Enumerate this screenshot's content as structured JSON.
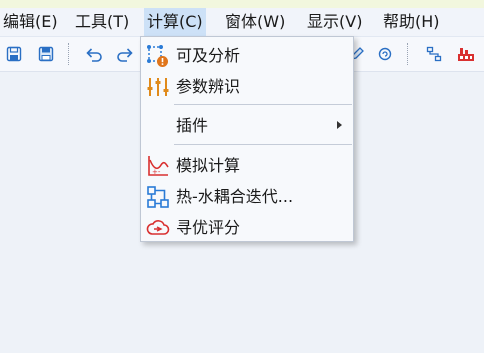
{
  "menubar": {
    "items": [
      {
        "label": "编辑(E)"
      },
      {
        "label": "工具(T)"
      },
      {
        "label": "计算(C)"
      },
      {
        "label": "窗体(W)"
      },
      {
        "label": "显示(V)"
      },
      {
        "label": "帮助(H)"
      }
    ],
    "active_index": 2
  },
  "toolbar": {
    "icons": [
      "save-icon",
      "save-as-icon",
      "undo-icon",
      "redo-icon",
      "edit-icon",
      "refresh-icon",
      "network-icon",
      "factory-icon"
    ]
  },
  "calc_menu": {
    "items": [
      {
        "label": "可及分析",
        "icon": "reachability-analysis-icon"
      },
      {
        "label": "参数辨识",
        "icon": "parameter-identification-icon"
      },
      {
        "label": "插件",
        "icon": "",
        "has_submenu": true
      },
      {
        "label": "模拟计算",
        "icon": "simulation-chart-icon"
      },
      {
        "label": "热-水耦合迭代...",
        "icon": "flow-diagram-icon"
      },
      {
        "label": "寻优评分",
        "icon": "cloud-optimization-icon"
      }
    ]
  },
  "colors": {
    "menu_highlight": "#cde1f7",
    "icon_blue": "#2a7bd6",
    "icon_red": "#d93030",
    "icon_orange": "#e08a1a"
  }
}
